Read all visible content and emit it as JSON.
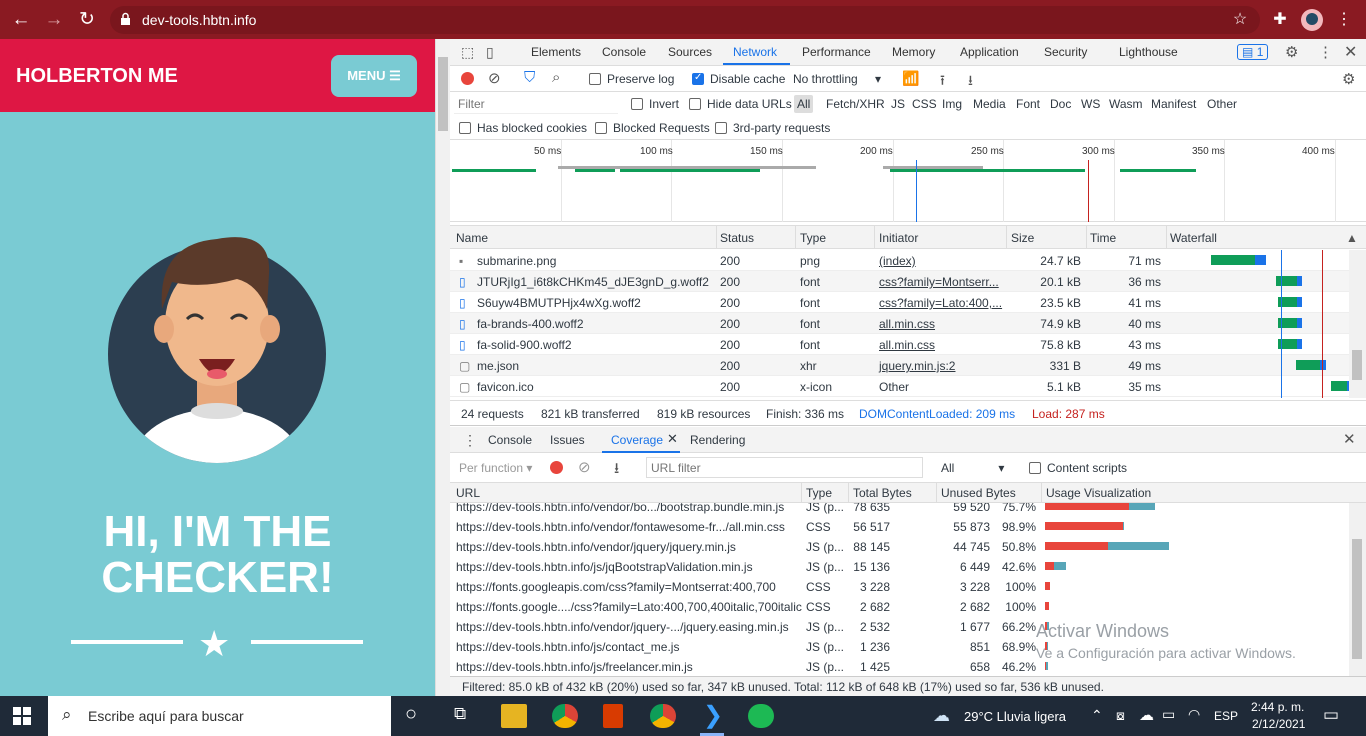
{
  "browser": {
    "url": "dev-tools.hbtn.info"
  },
  "site": {
    "brand": "HOLBERTON ME",
    "menu_label": "MENU",
    "hero_line1": "HI, I'M THE",
    "hero_line2": "CHECKER!"
  },
  "devtools": {
    "tabs": [
      "Elements",
      "Console",
      "Sources",
      "Network",
      "Performance",
      "Memory",
      "Application",
      "Security",
      "Lighthouse"
    ],
    "active_tab": "Network",
    "issues_badge": "1",
    "toolbar": {
      "preserve_log": "Preserve log",
      "disable_cache": "Disable cache",
      "throttling": "No throttling"
    },
    "filter": {
      "placeholder": "Filter",
      "invert": "Invert",
      "hide_data_urls": "Hide data URLs",
      "types": [
        "All",
        "Fetch/XHR",
        "JS",
        "CSS",
        "Img",
        "Media",
        "Font",
        "Doc",
        "WS",
        "Wasm",
        "Manifest",
        "Other"
      ],
      "has_blocked_cookies": "Has blocked cookies",
      "blocked_requests": "Blocked Requests",
      "third_party": "3rd-party requests"
    },
    "overview_ticks": [
      "50 ms",
      "100 ms",
      "150 ms",
      "200 ms",
      "250 ms",
      "300 ms",
      "350 ms",
      "400 ms"
    ],
    "columns": [
      "Name",
      "Status",
      "Type",
      "Initiator",
      "Size",
      "Time",
      "Waterfall"
    ],
    "requests": [
      {
        "name": "submarine.png",
        "status": "200",
        "type": "png",
        "initiator": "(index)",
        "size": "24.7 kB",
        "time": "71 ms"
      },
      {
        "name": "JTURjIg1_i6t8kCHKm45_dJE3gnD_g.woff2",
        "status": "200",
        "type": "font",
        "initiator": "css?family=Montserr...",
        "size": "20.1 kB",
        "time": "36 ms"
      },
      {
        "name": "S6uyw4BMUTPHjx4wXg.woff2",
        "status": "200",
        "type": "font",
        "initiator": "css?family=Lato:400,...",
        "size": "23.5 kB",
        "time": "41 ms"
      },
      {
        "name": "fa-brands-400.woff2",
        "status": "200",
        "type": "font",
        "initiator": "all.min.css",
        "size": "74.9 kB",
        "time": "40 ms"
      },
      {
        "name": "fa-solid-900.woff2",
        "status": "200",
        "type": "font",
        "initiator": "all.min.css",
        "size": "75.8 kB",
        "time": "43 ms"
      },
      {
        "name": "me.json",
        "status": "200",
        "type": "xhr",
        "initiator": "jquery.min.js:2",
        "size": "331 B",
        "time": "49 ms"
      },
      {
        "name": "favicon.ico",
        "status": "200",
        "type": "x-icon",
        "initiator": "Other",
        "size": "5.1 kB",
        "time": "35 ms"
      }
    ],
    "summary": {
      "requests": "24 requests",
      "transferred": "821 kB transferred",
      "resources": "819 kB resources",
      "finish": "Finish: 336 ms",
      "dcl": "DOMContentLoaded: 209 ms",
      "load": "Load: 287 ms"
    },
    "drawer_tabs": [
      "Console",
      "Issues",
      "Coverage",
      "Rendering"
    ],
    "coverage": {
      "mode": "Per function",
      "url_filter_placeholder": "URL filter",
      "type_filter": "All",
      "content_scripts": "Content scripts",
      "columns": [
        "URL",
        "Type",
        "Total Bytes",
        "Unused Bytes",
        "Usage Visualization"
      ],
      "rows": [
        {
          "url": "https://dev-tools.hbtn.info/vendor/bo.../bootstrap.bundle.min.js",
          "type": "JS (p...",
          "total": "78 635",
          "unused": "59 520",
          "pct": "75.7%",
          "used_frac": 0.243,
          "total_frac": 0.89
        },
        {
          "url": "https://dev-tools.hbtn.info/vendor/fontawesome-fr.../all.min.css",
          "type": "CSS",
          "total": "56 517",
          "unused": "55 873",
          "pct": "98.9%",
          "used_frac": 0.011,
          "total_frac": 0.64
        },
        {
          "url": "https://dev-tools.hbtn.info/vendor/jquery/jquery.min.js",
          "type": "JS (p...",
          "total": "88 145",
          "unused": "44 745",
          "pct": "50.8%",
          "used_frac": 0.492,
          "total_frac": 1.0
        },
        {
          "url": "https://dev-tools.hbtn.info/js/jqBootstrapValidation.min.js",
          "type": "JS (p...",
          "total": "15 136",
          "unused": "6 449",
          "pct": "42.6%",
          "used_frac": 0.574,
          "total_frac": 0.17
        },
        {
          "url": "https://fonts.googleapis.com/css?family=Montserrat:400,700",
          "type": "CSS",
          "total": "3 228",
          "unused": "3 228",
          "pct": "100%",
          "used_frac": 0.0,
          "total_frac": 0.037
        },
        {
          "url": "https://fonts.google..../css?family=Lato:400,700,400italic,700italic",
          "type": "CSS",
          "total": "2 682",
          "unused": "2 682",
          "pct": "100%",
          "used_frac": 0.0,
          "total_frac": 0.03
        },
        {
          "url": "https://dev-tools.hbtn.info/vendor/jquery-.../jquery.easing.min.js",
          "type": "JS (p...",
          "total": "2 532",
          "unused": "1 677",
          "pct": "66.2%",
          "used_frac": 0.338,
          "total_frac": 0.029
        },
        {
          "url": "https://dev-tools.hbtn.info/js/contact_me.js",
          "type": "JS (p...",
          "total": "1 236",
          "unused": "851",
          "pct": "68.9%",
          "used_frac": 0.311,
          "total_frac": 0.014
        },
        {
          "url": "https://dev-tools.hbtn.info/js/freelancer.min.js",
          "type": "JS (p...",
          "total": "1 425",
          "unused": "658",
          "pct": "46.2%",
          "used_frac": 0.538,
          "total_frac": 0.016
        }
      ],
      "footer": "Filtered: 85.0 kB of 432 kB (20%) used so far, 347 kB unused. Total: 112 kB of 648 kB (17%) used so far, 536 kB unused."
    },
    "watermark_line1": "Activar Windows",
    "watermark_line2": "Ve a Configuración para activar Windows."
  },
  "taskbar": {
    "search_placeholder": "Escribe aquí para buscar",
    "weather": "29°C  Lluvia ligera",
    "lang": "ESP",
    "time": "2:44 p. m.",
    "date": "2/12/2021"
  },
  "colors": {
    "browser_bar": "#8a1a22",
    "site_header": "#de1744",
    "site_bg": "#7acbd3",
    "accent": "#1a73e8",
    "unused_bar": "#e8453c",
    "used_bar": "#58a6b8"
  }
}
